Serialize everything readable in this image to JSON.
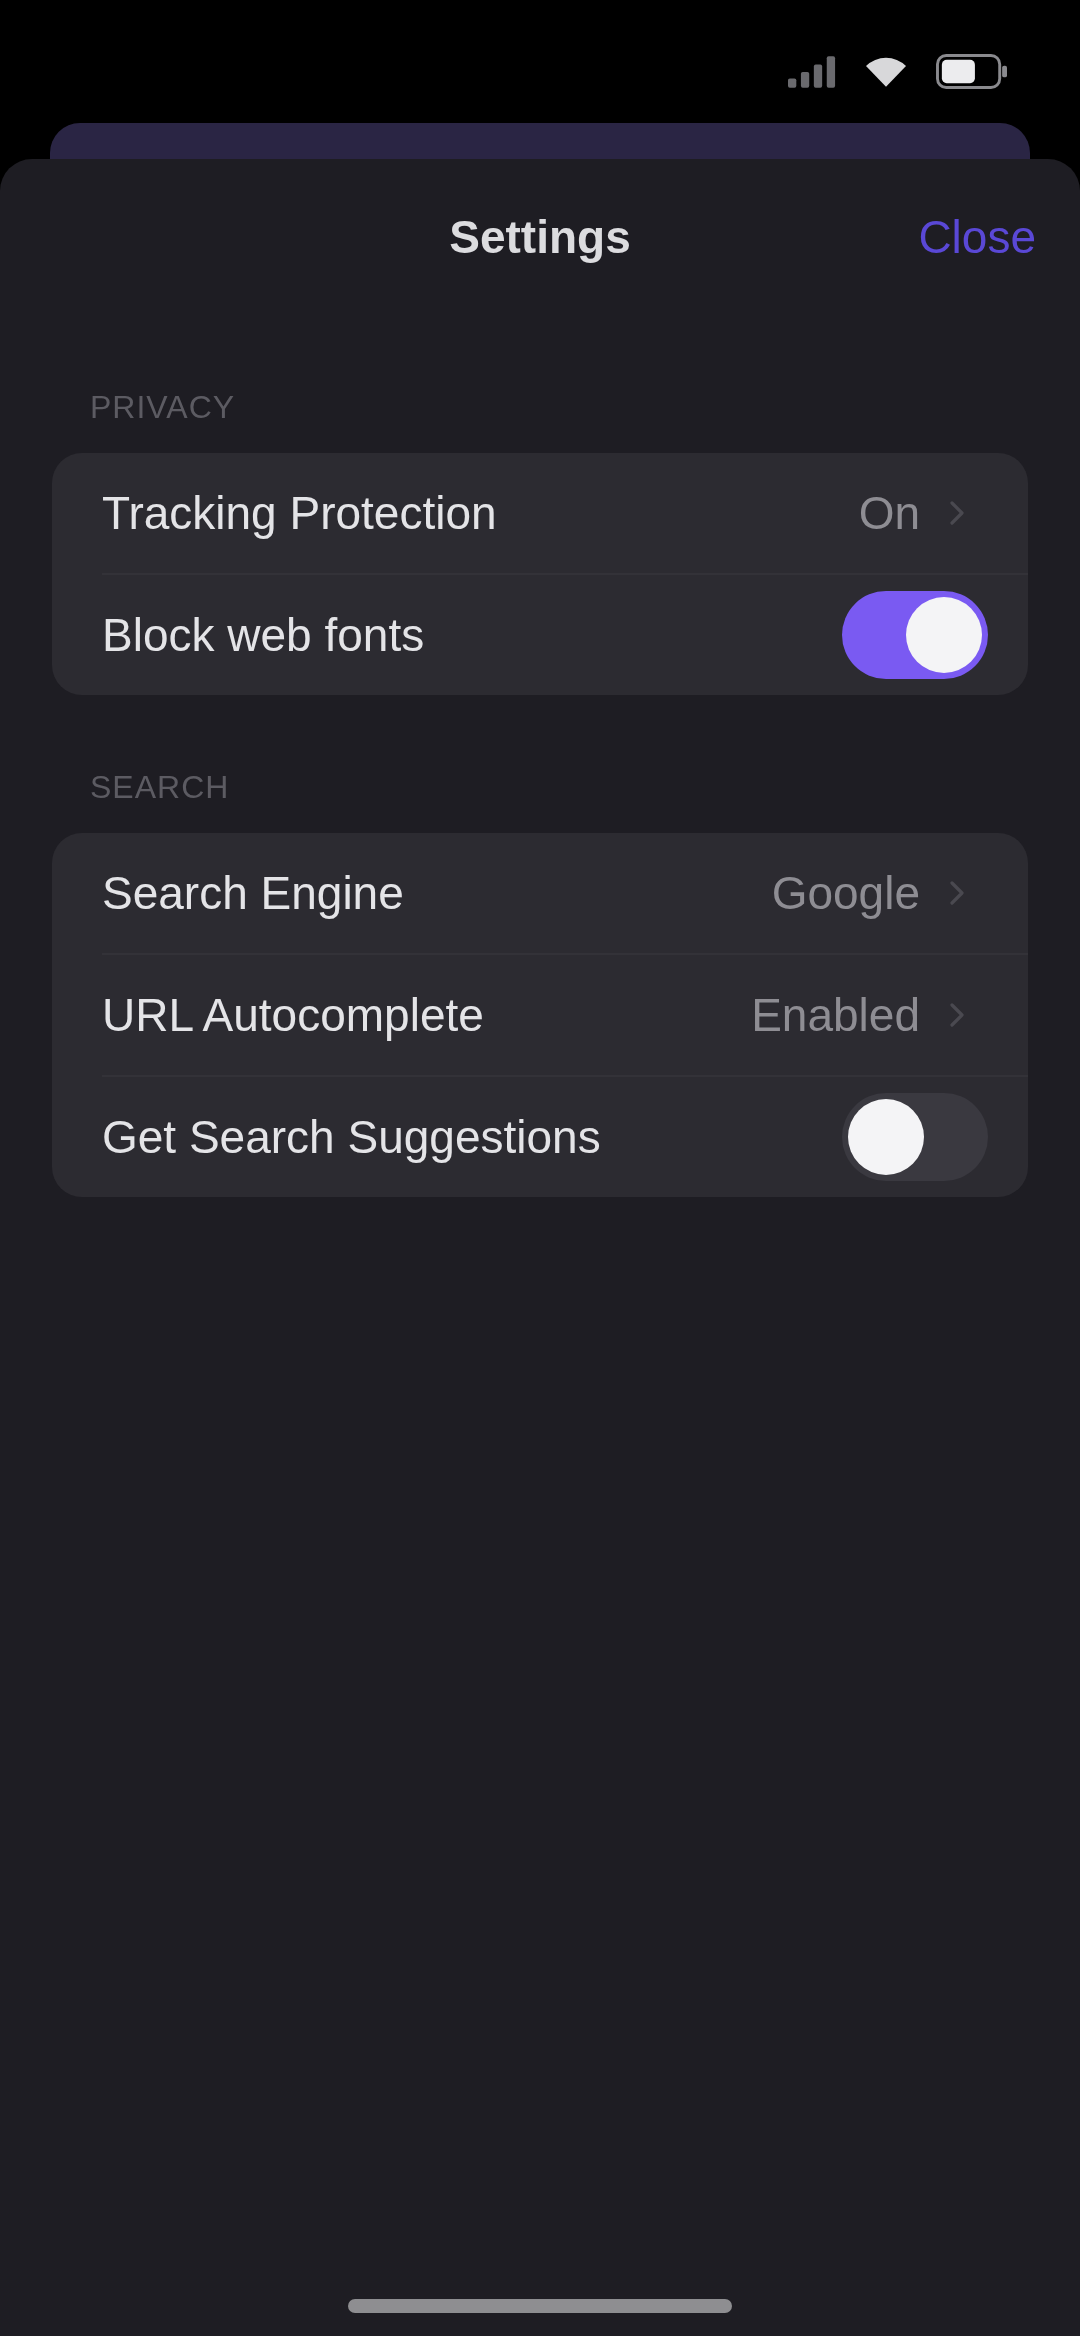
{
  "sheet": {
    "title": "Settings",
    "close_label": "Close"
  },
  "sections": [
    {
      "header": "PRIVACY",
      "rows": [
        {
          "kind": "value",
          "label": "Tracking Protection",
          "value": "On"
        },
        {
          "kind": "toggle",
          "label": "Block web fonts",
          "on": true
        }
      ]
    },
    {
      "header": "SEARCH",
      "rows": [
        {
          "kind": "value",
          "label": "Search Engine",
          "value": "Google"
        },
        {
          "kind": "value",
          "label": "URL Autocomplete",
          "value": "Enabled"
        },
        {
          "kind": "toggle",
          "label": "Get Search Suggestions",
          "on": false
        }
      ]
    }
  ]
}
